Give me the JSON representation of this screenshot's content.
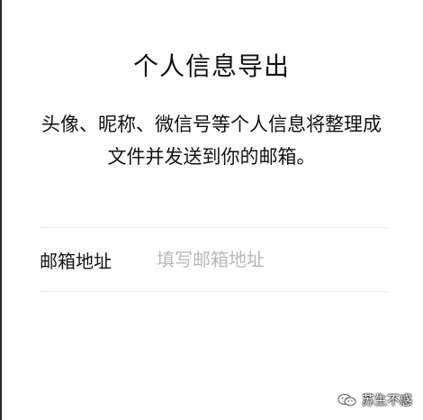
{
  "page": {
    "title": "个人信息导出",
    "description": "头像、昵称、微信号等个人信息将整理成文件并发送到你的邮箱。"
  },
  "form": {
    "email_label": "邮箱地址",
    "email_value": "",
    "email_placeholder": "填写邮箱地址"
  },
  "watermark": {
    "icon": "wechat-icon",
    "text": "苏生不惑"
  }
}
